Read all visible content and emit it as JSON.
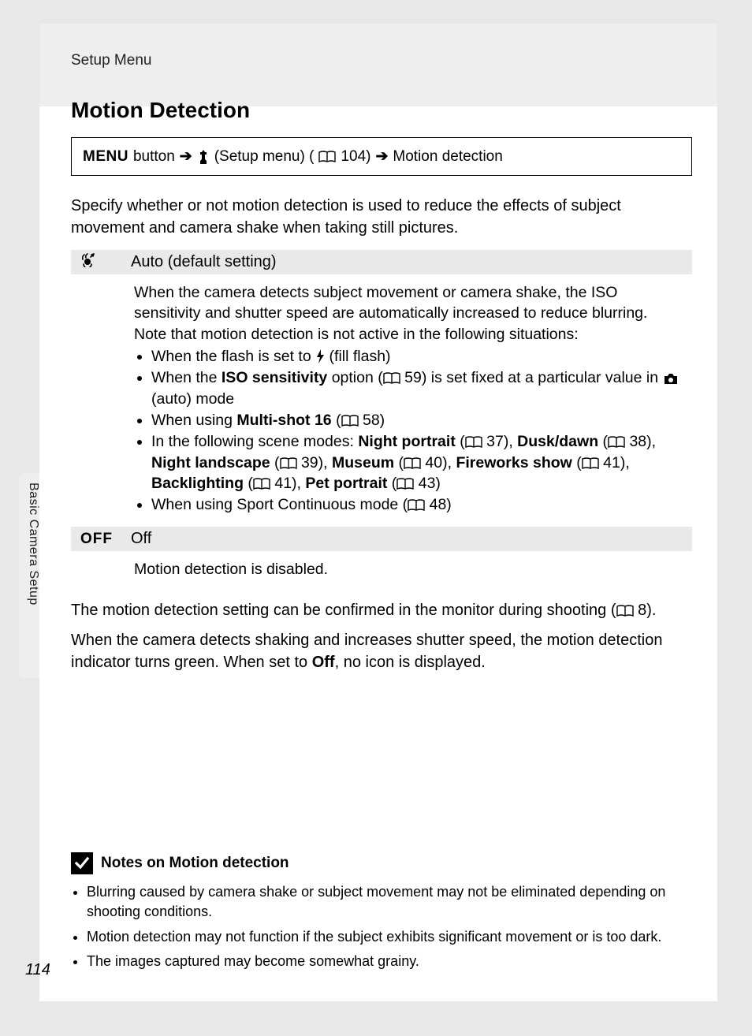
{
  "breadcrumb": "Setup Menu",
  "title": "Motion Detection",
  "nav": {
    "menu": "MENU",
    "button": " button",
    "setup": " (Setup menu) (",
    "pageref1": " 104) ",
    "dest": " Motion detection"
  },
  "intro": "Specify whether or not motion detection is used to reduce the effects of subject movement and camera shake when taking still pictures.",
  "auto": {
    "label": "Auto (default setting)",
    "p1": "When the camera detects subject movement or camera shake, the ISO sensitivity and shutter speed are automatically increased to reduce blurring.",
    "p2": "Note that motion detection is not active in the following situations:",
    "li1a": "When the flash is set to ",
    "li1b": " (fill flash)",
    "li2a": "When the ",
    "li2b": "ISO sensitivity",
    "li2c": " option (",
    "li2d": " 59) is set fixed at a particular value in ",
    "li2e": " (auto) mode",
    "li3a": "When using ",
    "li3b": "Multi-shot 16",
    "li3c": " (",
    "li3d": " 58)",
    "li4a": "In the following scene modes: ",
    "li4b": "Night portrait",
    "li4c": " (",
    "li4d": " 37), ",
    "li4e": "Dusk/dawn",
    "li4f": " (",
    "li4g": " 38), ",
    "li4h": "Night landscape",
    "li4i": " (",
    "li4j": " 39), ",
    "li4k": "Museum",
    "li4l": " (",
    "li4m": " 40), ",
    "li4n": "Fireworks show",
    "li4o": " (",
    "li4p": " 41), ",
    "li4q": "Backlighting",
    "li4r": " (",
    "li4s": " 41), ",
    "li4t": "Pet portrait",
    "li4u": " (",
    "li4v": " 43)",
    "li5a": "When using Sport Continuous mode (",
    "li5b": " 48)"
  },
  "off": {
    "symbol": "OFF",
    "label": "Off",
    "body": "Motion detection is disabled."
  },
  "para1a": "The motion detection setting can be confirmed in the monitor during shooting (",
  "para1b": " 8).",
  "para2a": "When the camera detects shaking and increases shutter speed, the motion detection indicator turns green. When set to ",
  "para2b": "Off",
  "para2c": ", no icon is displayed.",
  "notes": {
    "title": "Notes on Motion detection",
    "li1": "Blurring caused by camera shake or subject movement may not be eliminated depending on shooting conditions.",
    "li2": "Motion detection may not function if the subject exhibits significant movement or is too dark.",
    "li3": "The images captured may become somewhat grainy."
  },
  "side_label": "Basic Camera Setup",
  "page_number": "114"
}
